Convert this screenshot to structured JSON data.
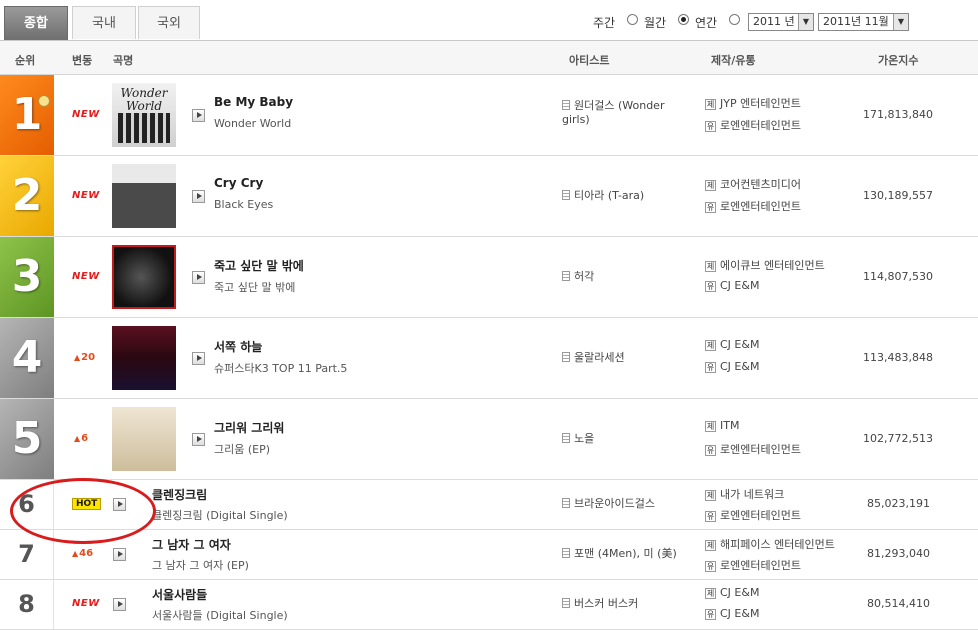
{
  "tabs": [
    {
      "label": "종합",
      "active": true
    },
    {
      "label": "국내",
      "active": false
    },
    {
      "label": "국외",
      "active": false
    }
  ],
  "period": {
    "options": [
      "주간",
      "월간",
      "연간"
    ],
    "selected": "월간",
    "year_select": "2011 년",
    "month_select": "2011년 11월"
  },
  "columns": {
    "rank": "순위",
    "change": "변동",
    "song": "곡명",
    "artist": "아티스트",
    "company": "제작/유통",
    "score": "가온지수"
  },
  "tag_labels": {
    "maker": "제",
    "distributor": "유"
  },
  "rows": [
    {
      "rank": "1",
      "change": "NEW",
      "change_type": "new",
      "title": "Be My Baby",
      "album": "Wonder World",
      "artist": "원더걸스 (Wonder girls)",
      "maker": "JYP 엔터테인먼트",
      "distributor": "로엔엔터테인먼트",
      "score": "171,813,840",
      "cover_text": "Wonder World",
      "cover_color": "#e9e9e9"
    },
    {
      "rank": "2",
      "change": "NEW",
      "change_type": "new",
      "title": "Cry Cry",
      "album": "Black Eyes",
      "artist": "티아라 (T-ara)",
      "maker": "코어컨텐츠미디어",
      "distributor": "로엔엔터테인먼트",
      "score": "130,189,557",
      "cover_text": "",
      "cover_color": "#3a3a3a"
    },
    {
      "rank": "3",
      "change": "NEW",
      "change_type": "new",
      "title": "죽고 싶단 말 밖에",
      "album": "죽고 싶단 말 밖에",
      "artist": "허각",
      "maker": "에이큐브 엔터테인먼트",
      "distributor": "CJ E&M",
      "score": "114,807,530",
      "cover_text": "",
      "cover_color": "#1c1c1c"
    },
    {
      "rank": "4",
      "change": "20",
      "change_type": "up",
      "title": "서쪽 하늘",
      "album": "슈퍼스타K3 TOP 11 Part.5",
      "artist": "울랄라세션",
      "maker": "CJ E&M",
      "distributor": "CJ E&M",
      "score": "113,483,848",
      "cover_text": "",
      "cover_color": "#5a1a2a"
    },
    {
      "rank": "5",
      "change": "6",
      "change_type": "up",
      "title": "그리워 그리워",
      "album": "그리움 (EP)",
      "artist": "노을",
      "maker": "ITM",
      "distributor": "로엔엔터테인먼트",
      "score": "102,772,513",
      "cover_text": "",
      "cover_color": "#d9cdb4"
    },
    {
      "rank": "6",
      "change": "HOT",
      "change_type": "hot",
      "title": "클렌징크림",
      "album": "클렌징크림 (Digital Single)",
      "artist": "브라운아이드걸스",
      "maker": "내가 네트워크",
      "distributor": "로엔엔터테인먼트",
      "score": "85,023,191"
    },
    {
      "rank": "7",
      "change": "46",
      "change_type": "up",
      "title": "그 남자 그 여자",
      "album": "그 남자 그 여자 (EP)",
      "artist": "포맨 (4Men), 미 (美)",
      "maker": "해피페이스 엔터테인먼트",
      "distributor": "로엔엔터테인먼트",
      "score": "81,293,040"
    },
    {
      "rank": "8",
      "change": "NEW",
      "change_type": "new",
      "title": "서울사람들",
      "album": "서울사람들 (Digital Single)",
      "artist": "버스커 버스커",
      "maker": "CJ E&M",
      "distributor": "CJ E&M",
      "score": "80,514,410"
    }
  ]
}
